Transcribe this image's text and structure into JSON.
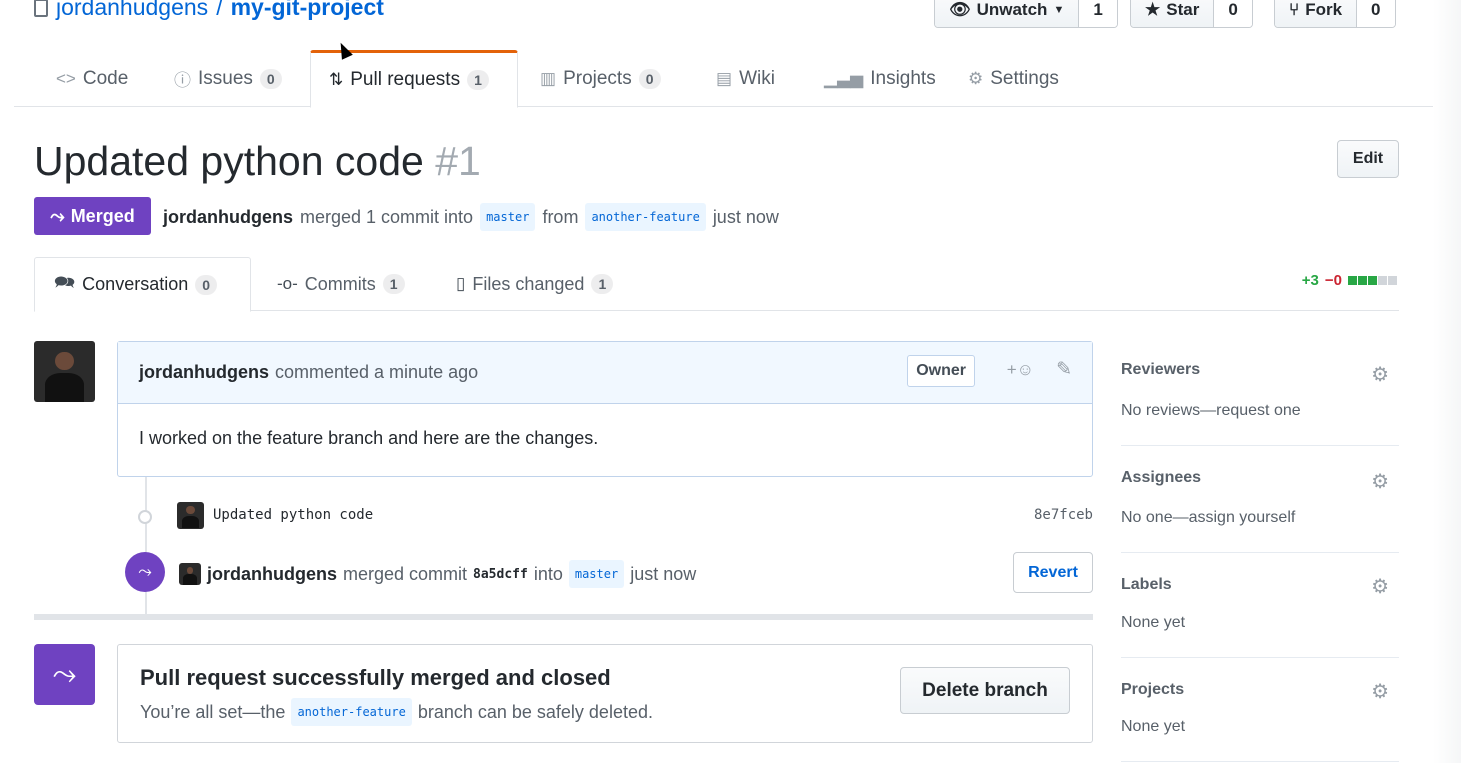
{
  "repo": {
    "owner": "jordanhudgens",
    "separator": "/",
    "name": "my-git-project",
    "unwatch_label": "Unwatch",
    "watch_count": "1",
    "star_label": "Star",
    "star_count": "0",
    "fork_label": "Fork",
    "fork_count": "0"
  },
  "repo_tabs": [
    {
      "label": "Code",
      "icon": "code-icon"
    },
    {
      "label": "Issues",
      "count": "0",
      "icon": "issue-icon"
    },
    {
      "label": "Pull requests",
      "count": "1",
      "icon": "pull-request-icon"
    },
    {
      "label": "Projects",
      "count": "0",
      "icon": "project-icon"
    },
    {
      "label": "Wiki",
      "icon": "book-icon"
    },
    {
      "label": "Insights",
      "icon": "graph-icon"
    },
    {
      "label": "Settings",
      "icon": "gear-icon"
    }
  ],
  "pr": {
    "title": "Updated python code",
    "number": "#1",
    "edit_label": "Edit",
    "state": "Merged",
    "author": "jordanhudgens",
    "merged_text": "merged 1 commit into",
    "base_branch": "master",
    "from_text": "from",
    "head_branch": "another-feature",
    "time": "just now"
  },
  "pr_tabs": [
    {
      "label": "Conversation",
      "count": "0",
      "icon": "comment-discussion-icon"
    },
    {
      "label": "Commits",
      "count": "1",
      "icon": "commit-icon"
    },
    {
      "label": "Files changed",
      "count": "1",
      "icon": "diff-icon"
    }
  ],
  "diffstat": {
    "additions": "+3",
    "deletions": "−0"
  },
  "comment": {
    "author": "jordanhudgens",
    "meta": "commented a minute ago",
    "badge": "Owner",
    "body": "I worked on the feature branch and here are the changes."
  },
  "commit": {
    "message": "Updated python code",
    "sha": "8e7fceb"
  },
  "merge_event": {
    "author": "jordanhudgens",
    "text": "merged commit",
    "sha": "8a5dcff",
    "into": "into",
    "branch": "master",
    "time": "just now",
    "revert_label": "Revert"
  },
  "merge_box": {
    "heading": "Pull request successfully merged and closed",
    "sub_prefix": "You’re all set—the",
    "branch": "another-feature",
    "sub_suffix": "branch can be safely deleted.",
    "delete_label": "Delete branch"
  },
  "sidebar": {
    "reviewers": {
      "title": "Reviewers",
      "value": "No reviews—request one"
    },
    "assignees": {
      "title": "Assignees",
      "value": "No one—assign yourself"
    },
    "labels": {
      "title": "Labels",
      "value": "None yet"
    },
    "projects": {
      "title": "Projects",
      "value": "None yet"
    }
  },
  "colors": {
    "merged": "#6f42c1",
    "link": "#0366d6",
    "addition": "#28a745",
    "deletion": "#cb2431",
    "selected_tab_border": "#e36209"
  }
}
